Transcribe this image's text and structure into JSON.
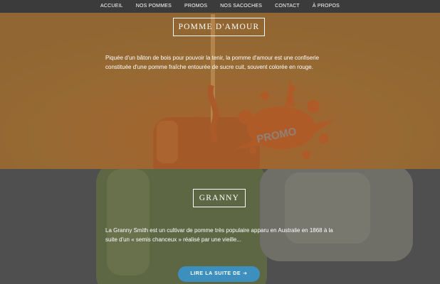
{
  "nav": {
    "items": [
      {
        "label": "ACCUEIL"
      },
      {
        "label": "NOS POMMES"
      },
      {
        "label": "PROMOS"
      },
      {
        "label": "NOS SACOCHES"
      },
      {
        "label": "CONTACT"
      },
      {
        "label": "À PROPOS"
      }
    ]
  },
  "apple_section": {
    "title": "POMME D'AMOUR",
    "description": "Piquée d'un bâton de bois pour pouvoir la tenir, la pomme d'amour est une confiserie constituée d'une pomme fraîche entourée de sucre cuit, souvent colorée en rouge.",
    "promo_badge": "PROMO"
  },
  "granny_section": {
    "title": "GRANNY",
    "description": "La Granny Smith est un cultivar de pomme très populaire apparu en Australie en 1868 à la suite d'un « semis chanceux » réalisé par une vieille...",
    "read_more_label": "LIRE LA SUITE DE",
    "read_more_icon": "arrow-right-icon"
  },
  "colors": {
    "nav_bg": "#3b3b3b",
    "apple_overlay": "#a06e32",
    "granny_overlay": "#5f5f5f",
    "button_bg": "#3d8fbd",
    "promo_splash": "#c0461e"
  }
}
